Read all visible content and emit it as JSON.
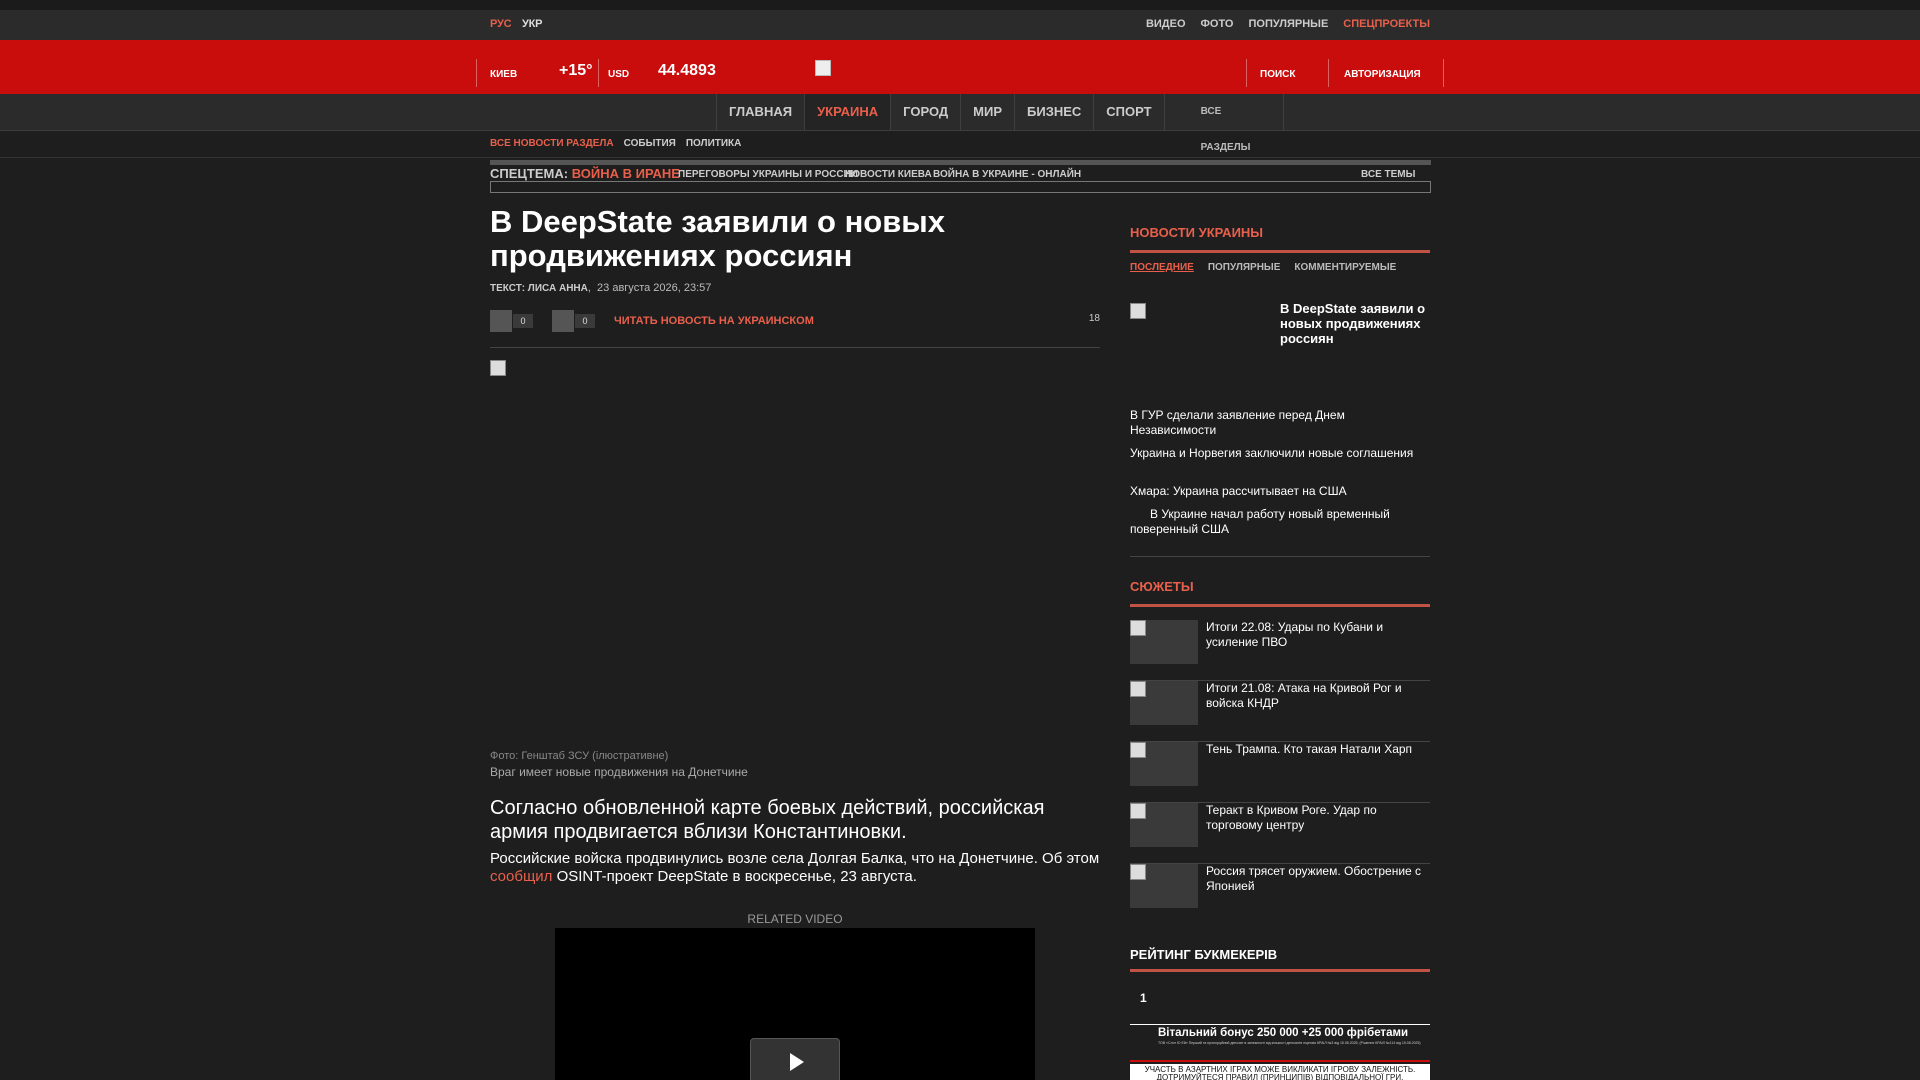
{
  "topbar": {
    "lang_ru": "РУС",
    "lang_uk": "УКР",
    "links": [
      "ВИДЕО",
      "ФОТО",
      "ПОПУЛЯРНЫЕ"
    ],
    "special": "СПЕЦПРОЕКТЫ"
  },
  "redbar": {
    "city": "КИЕВ",
    "temp": "+15°",
    "currency": "USD",
    "rate": "44.4893",
    "search": "ПОИСК",
    "auth": "АВТОРИЗАЦИЯ"
  },
  "mainnav": {
    "items": [
      "ГЛАВНАЯ",
      "УКРАИНА",
      "ГОРОД",
      "МИР",
      "БИЗНЕС",
      "СПОРТ"
    ],
    "all": "ВСЕ РАЗДЕЛЫ"
  },
  "subnav": {
    "all_news": "ВСЕ НОВОСТИ РАЗДЕЛА",
    "items": [
      "СОБЫТИЯ",
      "ПОЛИТИКА"
    ]
  },
  "themes": {
    "label": "СПЕЦТЕМА:",
    "highlight": "ВОЙНА В ИРАНЕ",
    "links": [
      "ПЕРЕГОВОРЫ УКРАИНЫ И РОССИИ",
      "НОВОСТИ КИЕВА",
      "ВОЙНА В УКРАИНЕ - ОНЛАЙН"
    ],
    "all": "ВСЕ ТЕМЫ"
  },
  "article": {
    "title": "В DeepState заявили о новых продвижениях россиян",
    "author": "ТЕКСТ: ЛИСА АННА",
    "date": "23 августа 2026, 23:57",
    "like_count": "0",
    "dislike_count": "0",
    "ua_link": "ЧИТАТЬ НОВОСТЬ НА УКРАИНСКОМ",
    "comments": "18",
    "photo_credit": "Фото: Генштаб ЗСУ (ілюстративне)",
    "photo_caption": "Враг имеет новые продвижения на Донетчине",
    "lead": "Согласно обновленной карте боевых действий, российская армия продвигается вблизи Константиновки.",
    "para_before": "Российские войска продвинулись возле села Долгая Балка, что на Донетчине. Об этом ",
    "para_link": "сообщил",
    "para_after": " OSINT-проект DeepState в воскресенье, 23 августа.",
    "related": "RELATED VIDEO"
  },
  "sidebar": {
    "news_title": "НОВОСТИ УКРАИНЫ",
    "tabs": [
      "ПОСЛЕДНИЕ",
      "ПОПУЛЯРНЫЕ",
      "КОММЕНТИРУЕМЫЕ"
    ],
    "featured": "В DeepState заявили о новых продвижениях россиян",
    "news": [
      "В ГУР сделали заявление перед Днем Независимости",
      "Украина и Норвегия заключили новые соглашения",
      "Хмара: Украина рассчитывает на США",
      "В Украине начал работу новый временный поверенный США"
    ],
    "stories_title": "СЮЖЕТЫ",
    "stories": [
      "Итоги 22.08: Удары по Кубани и усиление ПВО",
      "Итоги 21.08: Атака на Кривой Рог и войска КНДР",
      "Тень Трампа. Кто такая Натали Харп",
      "Теракт в Кривом Роге. Удар по торговому центру",
      "Россия трясет оружием. Обострение с Японией"
    ],
    "rating_title": "РЕЙТИНГ БУКМЕКЕРІВ",
    "rating_num": "1",
    "bonus": "Вітальний бонус 250 000 +25 000 фрібетами",
    "bonus_small": "ТОВ «Слот Ю Ей» Перший та пропорційний депозит в залежності від кількості депозитів ліцензія КРАІЛ №3 від 15.08.2025; (Рішення КРАІЛ №114 від 15.08.2025)",
    "warning": "УЧАСТЬ В АЗАРТНИХ ІГРАХ МОЖЕ ВИКЛИКАТИ ІГРОВУ ЗАЛЕЖНІСТЬ. ДОТРИМУЙТЕСЯ ПРАВИЛ (ПРИНЦИПІВ) ВІДПОВІДАЛЬНОЇ ГРИ."
  }
}
